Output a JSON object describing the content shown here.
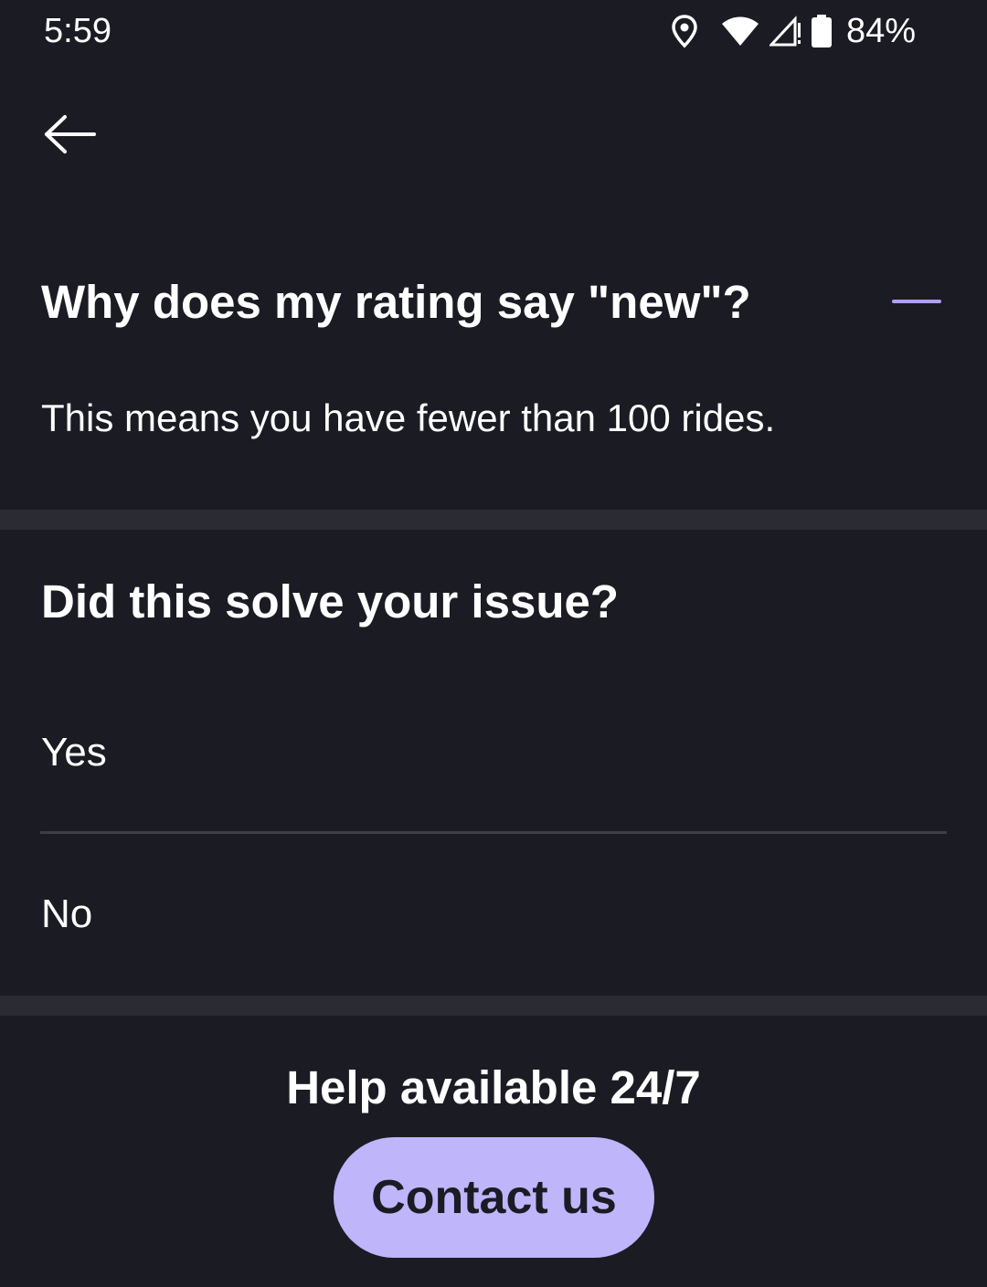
{
  "status_bar": {
    "time": "5:59",
    "battery_percent": "84%",
    "icons": [
      "location-icon",
      "wifi-icon",
      "signal-icon",
      "battery-icon"
    ]
  },
  "nav": {
    "back_icon": "arrow-left-icon"
  },
  "faq": {
    "question": "Why does my rating say \"new\"?",
    "answer": "This means you have fewer than 100 rides.",
    "toggle_icon": "minus-collapse-icon"
  },
  "feedback": {
    "title": "Did this solve your issue?",
    "options": [
      {
        "label": "Yes"
      },
      {
        "label": "No"
      }
    ]
  },
  "help": {
    "heading": "Help available 24/7",
    "contact_label": "Contact us"
  },
  "colors": {
    "background": "#1b1b24",
    "divider": "#2a2b33",
    "accent": "#b29ef5",
    "button": "#beb5fb",
    "button_text": "#1b1b24"
  }
}
